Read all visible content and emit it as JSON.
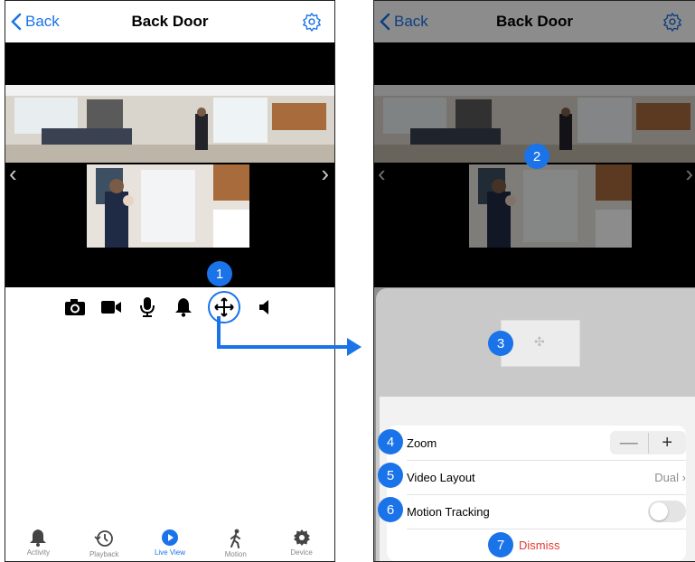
{
  "screen": {
    "back_label": "Back",
    "title": "Back Door",
    "dismiss_label": "Dismiss",
    "rows": {
      "zoom_label": "Zoom",
      "zoom_minus": "—",
      "zoom_plus": "+",
      "video_layout_label": "Video Layout",
      "video_layout_value": "Dual",
      "motion_tracking_label": "Motion Tracking",
      "motion_tracking_on": false
    }
  },
  "controls": [
    "camera-icon",
    "video-record-icon",
    "microphone-icon",
    "bell-icon",
    "pan-tilt-icon",
    "speaker-icon"
  ],
  "tabbar": {
    "items": [
      {
        "label": "Activity",
        "icon": "bell-icon"
      },
      {
        "label": "Playback",
        "icon": "history-icon"
      },
      {
        "label": "Live View",
        "icon": "play-icon"
      },
      {
        "label": "Motion",
        "icon": "walking-person-icon"
      },
      {
        "label": "Device",
        "icon": "gear-icon"
      }
    ]
  },
  "callouts": [
    "1",
    "2",
    "3",
    "4",
    "5",
    "6",
    "7"
  ],
  "colors": {
    "accent": "#1a73e8",
    "dismiss": "#e53935",
    "sheet_bg": "#c9c9c9"
  }
}
